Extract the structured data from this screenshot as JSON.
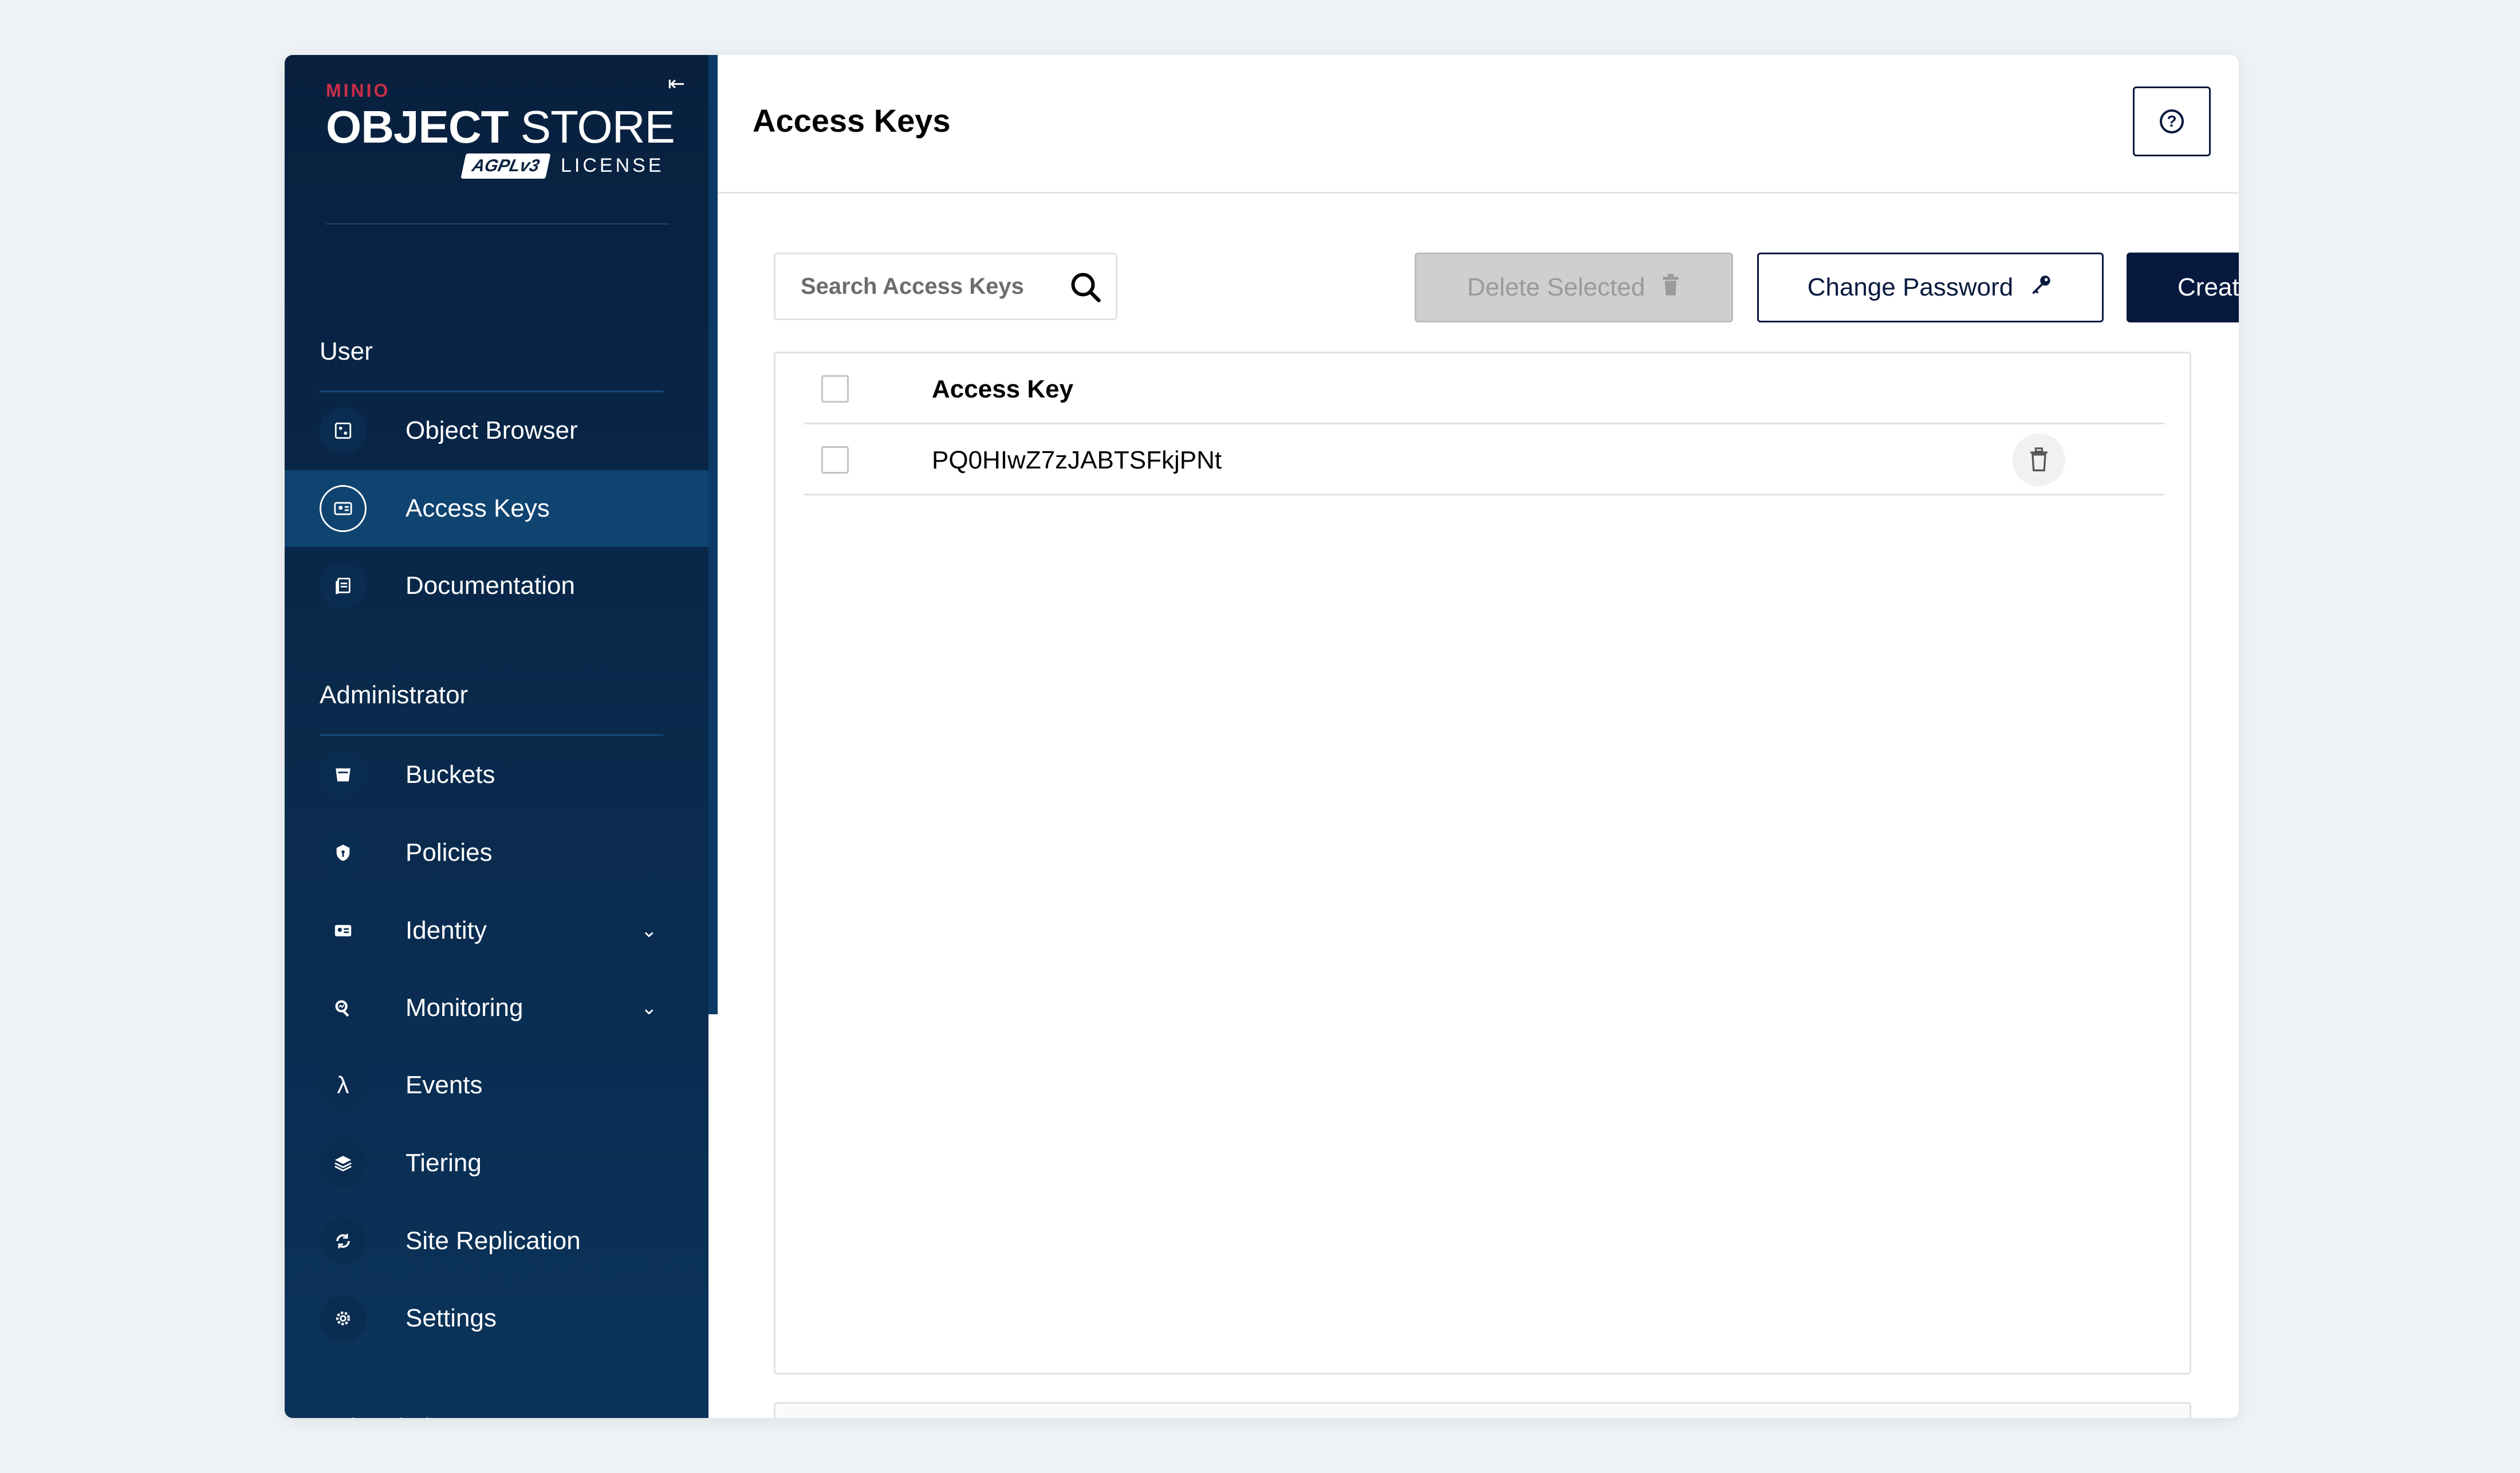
{
  "logo": {
    "brand": "MINIO",
    "product_bold": "OBJECT",
    "product_rest": " STORE",
    "badge": "AGPLv3",
    "license": "LICENSE"
  },
  "sidebar": {
    "sections": [
      {
        "title": "User"
      },
      {
        "title": "Administrator"
      },
      {
        "title": "Subscription"
      }
    ],
    "user_items": [
      {
        "label": "Object Browser",
        "icon": "object-browser-icon"
      },
      {
        "label": "Access Keys",
        "icon": "access-keys-icon",
        "active": true
      },
      {
        "label": "Documentation",
        "icon": "documentation-icon"
      }
    ],
    "admin_items": [
      {
        "label": "Buckets",
        "icon": "buckets-icon"
      },
      {
        "label": "Policies",
        "icon": "policies-icon"
      },
      {
        "label": "Identity",
        "icon": "identity-icon",
        "expandable": true
      },
      {
        "label": "Monitoring",
        "icon": "monitoring-icon",
        "expandable": true
      },
      {
        "label": "Events",
        "icon": "lambda-icon"
      },
      {
        "label": "Tiering",
        "icon": "tiering-icon"
      },
      {
        "label": "Site Replication",
        "icon": "replication-icon"
      },
      {
        "label": "Settings",
        "icon": "gear-icon"
      }
    ]
  },
  "header": {
    "title": "Access Keys"
  },
  "toolbar": {
    "search_placeholder": "Search Access Keys",
    "delete_selected_label": "Delete Selected",
    "change_password_label": "Change Password",
    "create_access_key_label": "Create access key"
  },
  "table": {
    "columns": [
      "Access Key"
    ],
    "rows": [
      {
        "access_key": "PQ0HIwZ7zJABTSFkjPNt"
      }
    ]
  },
  "colors": {
    "sidebar_top": "#08203e",
    "sidebar_bottom": "#0b335a",
    "active_item": "#0f4370",
    "primary": "#07193e",
    "brand_red": "#c72e49"
  }
}
